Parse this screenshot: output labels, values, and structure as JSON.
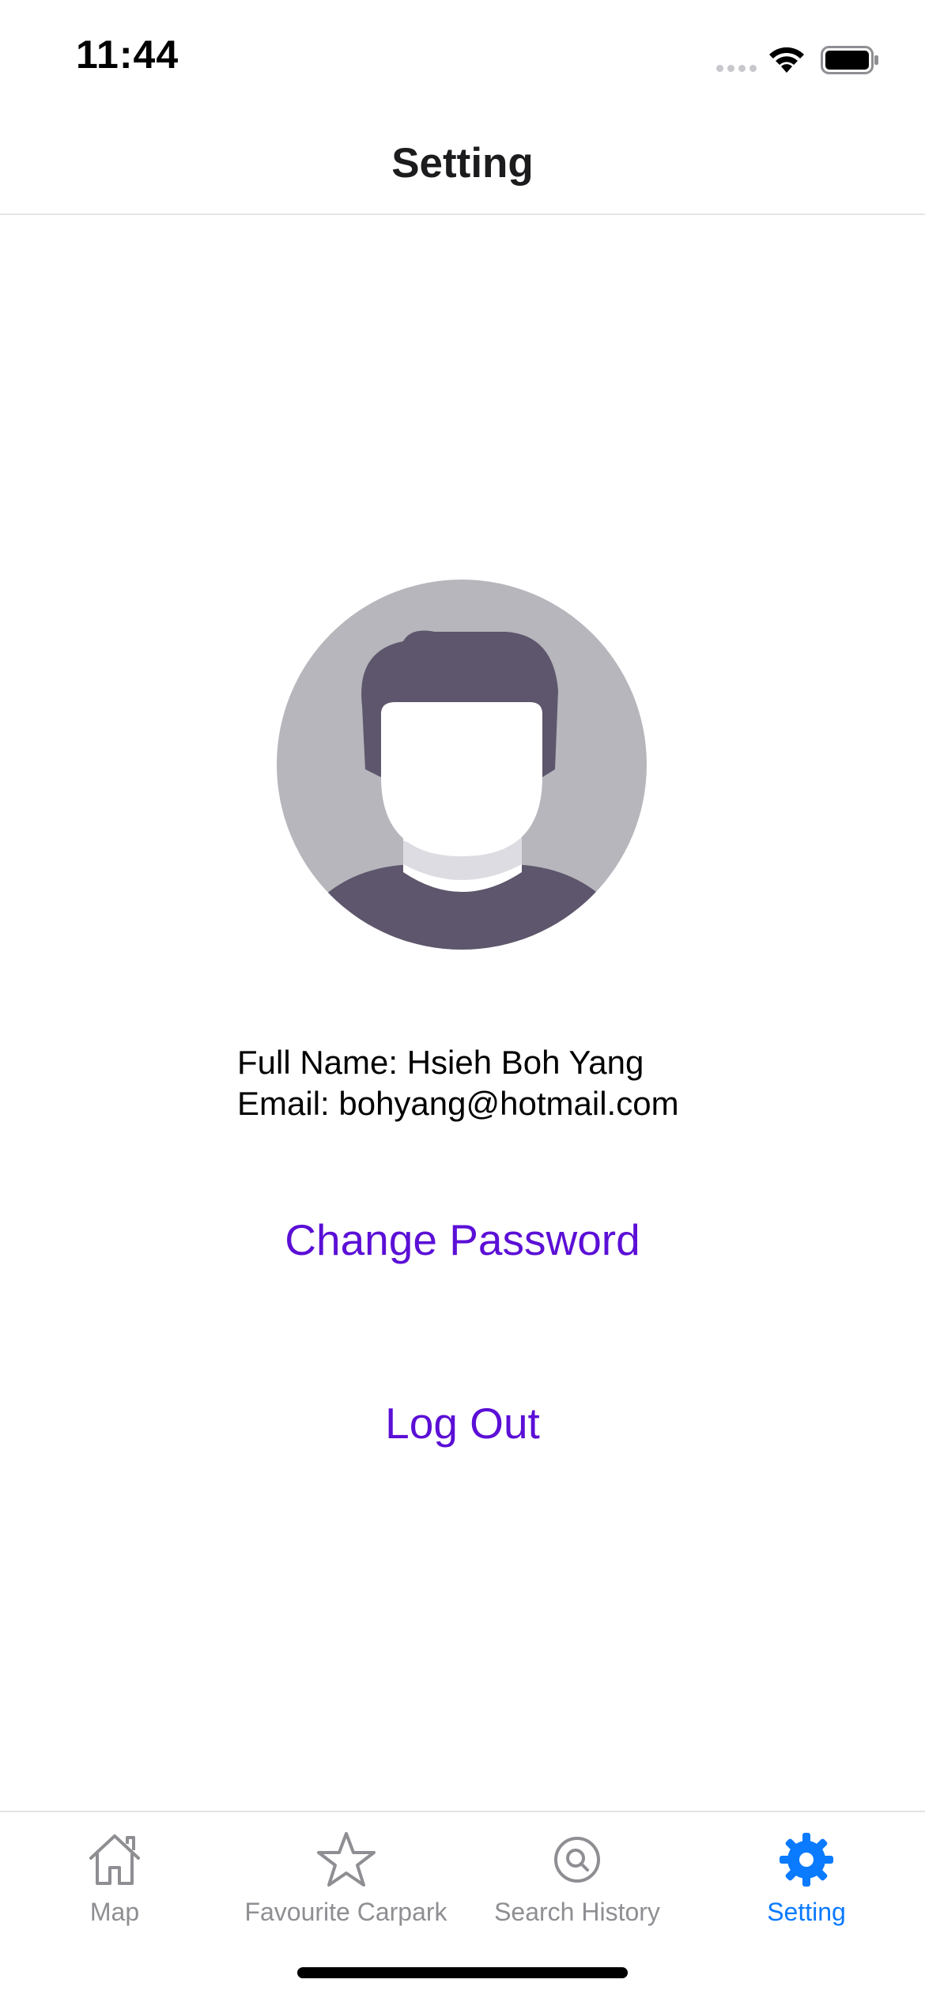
{
  "status_bar": {
    "time": "11:44"
  },
  "header": {
    "title": "Setting"
  },
  "profile": {
    "full_name_line": "Full Name: Hsieh Boh Yang",
    "email_line": "Email: bohyang@hotmail.com"
  },
  "actions": {
    "change_password": "Change Password",
    "log_out": "Log Out"
  },
  "tab_bar": {
    "tabs": [
      {
        "label": "Map",
        "icon": "house-icon",
        "active": false
      },
      {
        "label": "Favourite Carpark",
        "icon": "star-icon",
        "active": false
      },
      {
        "label": "Search History",
        "icon": "search-circle-icon",
        "active": false
      },
      {
        "label": "Setting",
        "icon": "gear-icon",
        "active": true
      }
    ]
  },
  "colors": {
    "accent_purple": "#5b0fd6",
    "active_tab_blue": "#0a7aff",
    "inactive_tab_gray": "#8e8e93",
    "avatar_bg": "#b6b6bc",
    "avatar_hair": "#5e566c"
  }
}
